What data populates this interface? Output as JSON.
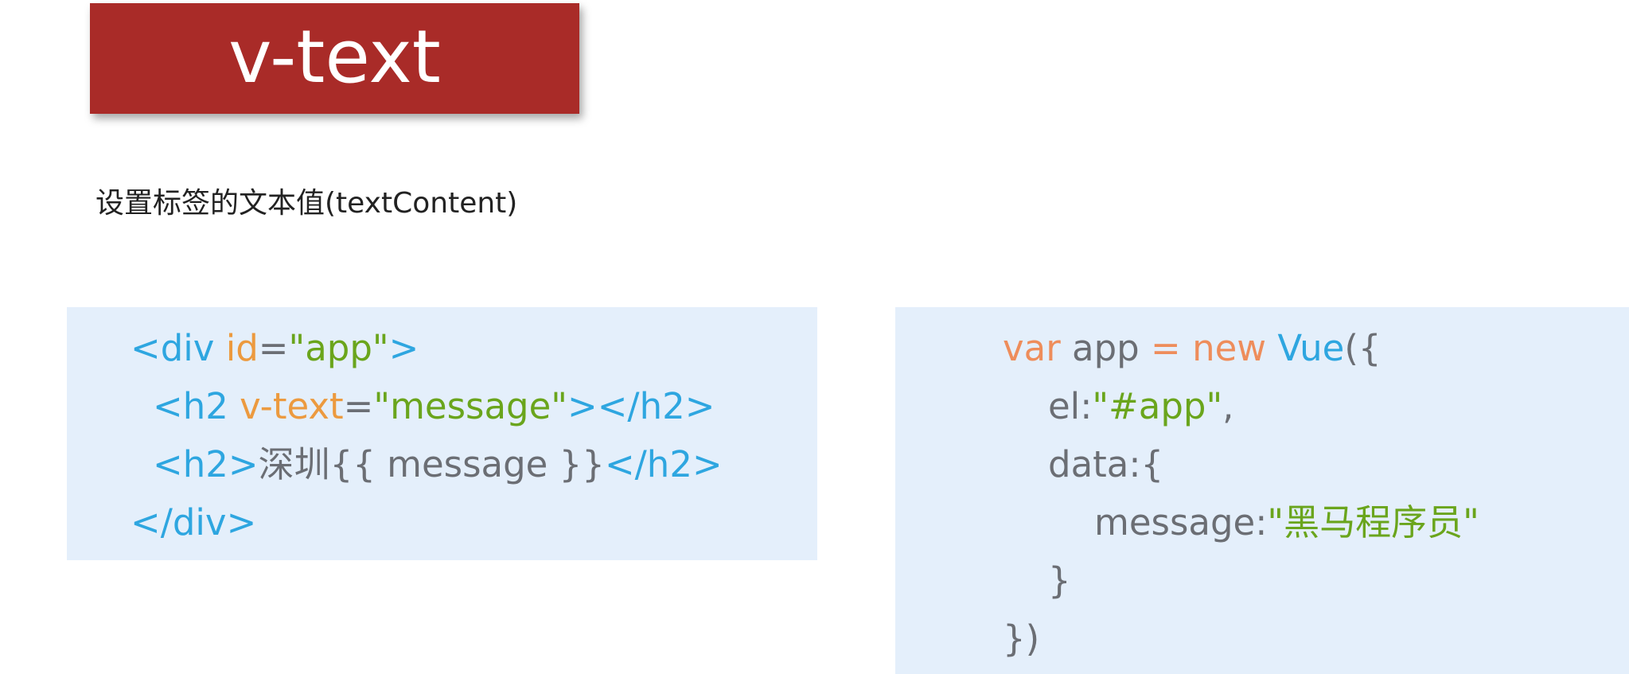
{
  "title": "v-text",
  "subtitle": "设置标签的文本值(textContent)",
  "colors": {
    "banner": "#a92b28",
    "panel": "#e4effb",
    "tag": "#2ea6e0",
    "attr": "#ec9a3f",
    "string": "#6aa51c",
    "plain": "#6b6e74",
    "keyword": "#ee8d5b"
  },
  "html_code": {
    "line1": {
      "open": "<div ",
      "attr": "id",
      "eq": "=",
      "value": "\"app\"",
      "close": ">"
    },
    "line2": {
      "open": "<h2 ",
      "attr": "v-text",
      "eq": "=",
      "value": "\"message\"",
      "close": "></h2>"
    },
    "line3": {
      "open": "<h2>",
      "text": "深圳{{ message }}",
      "close": "</h2>"
    },
    "line4": {
      "close": "</div>"
    }
  },
  "js_code": {
    "line1": {
      "var": "var",
      "name": " app ",
      "eq": "=",
      "new": " new ",
      "vue": "Vue",
      "rest": "({"
    },
    "line2": {
      "key": "el:",
      "value": "\"#app\"",
      "rest": ","
    },
    "line3": {
      "key": "data:{"
    },
    "line4": {
      "key": "message:",
      "value": "\"黑马程序员\""
    },
    "line5": {
      "text": "}"
    },
    "line6": {
      "text": "})"
    }
  }
}
